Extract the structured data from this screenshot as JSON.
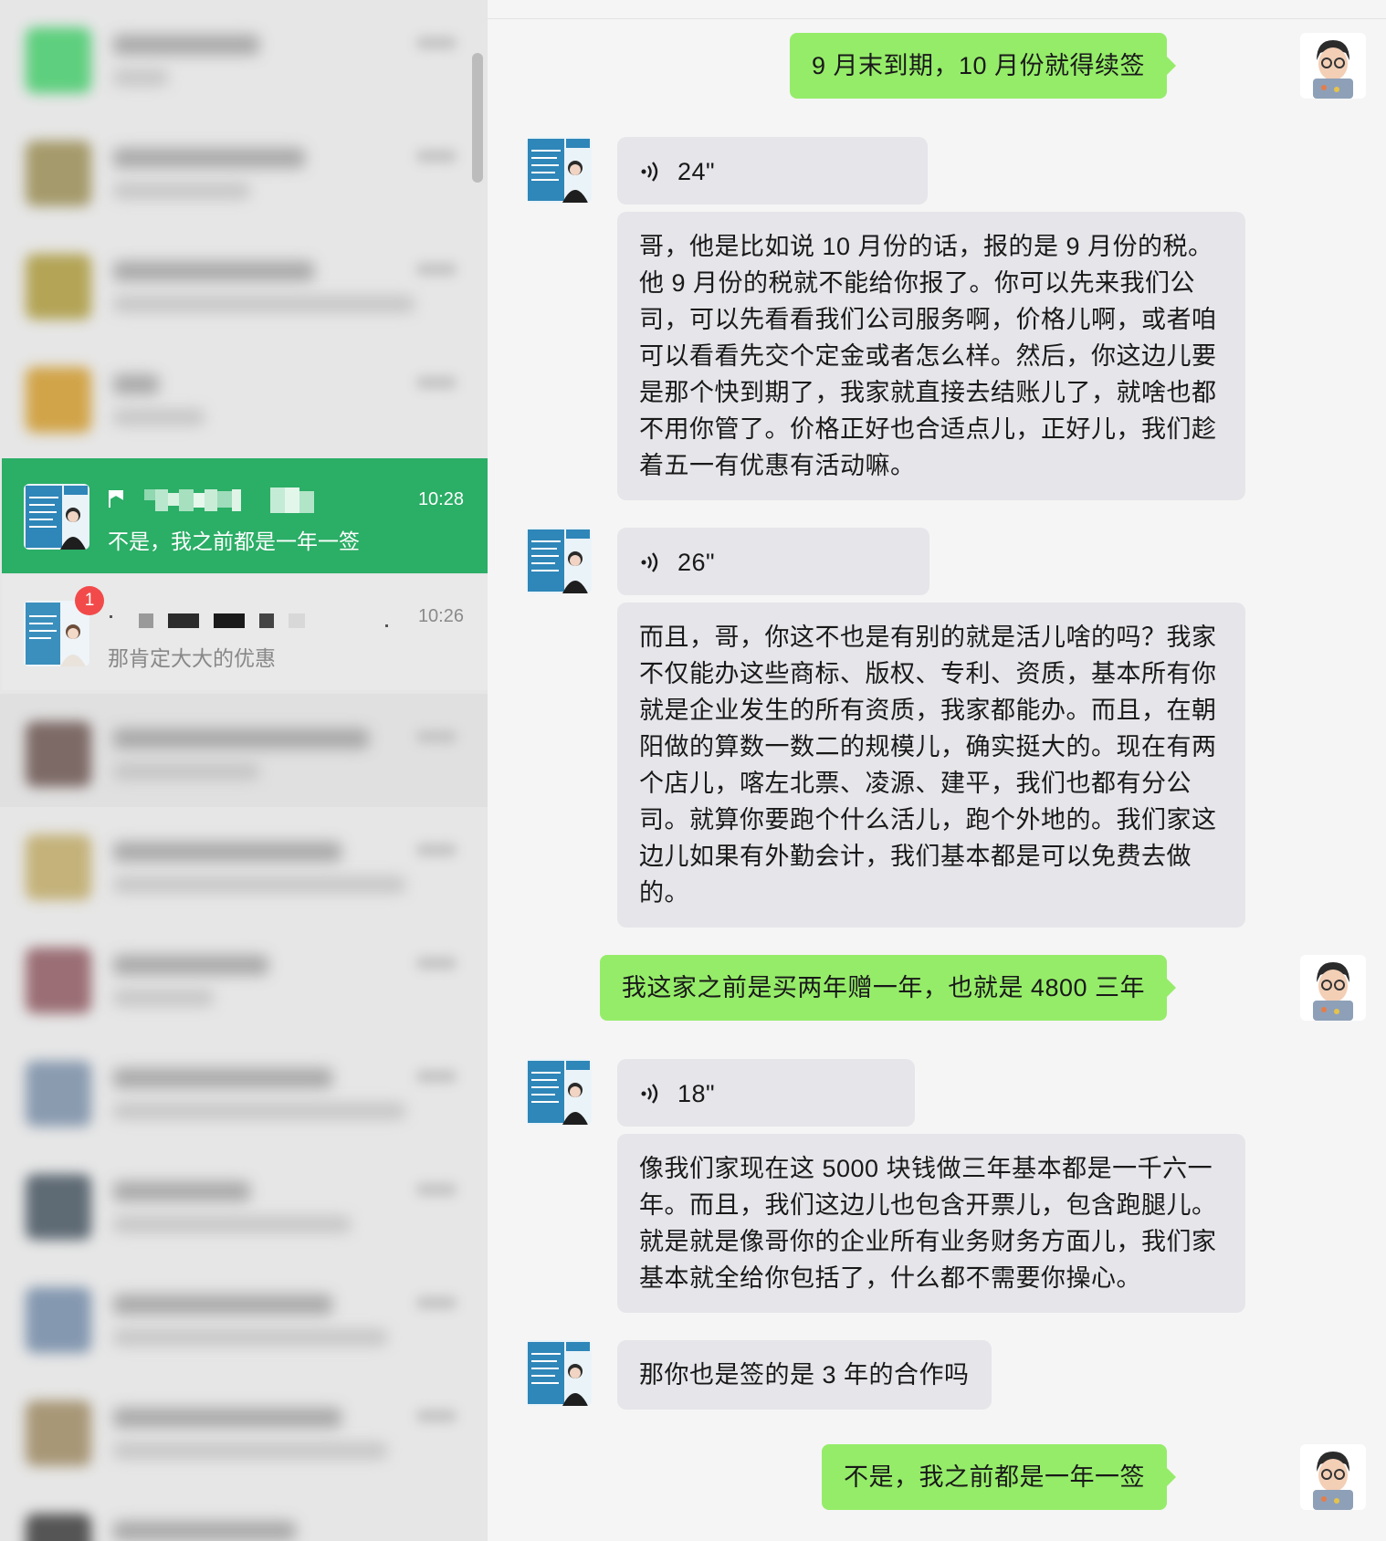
{
  "sidebar": {
    "active_conversation": {
      "time": "10:28",
      "preview": "不是，我之前都是一年一签"
    },
    "second_conversation": {
      "time": "10:26",
      "preview": "那肯定大大的优惠",
      "unread_count": "1"
    }
  },
  "messages": [
    {
      "from": "me",
      "type": "text",
      "text": "9 月末到期，10 月份就得续签"
    },
    {
      "from": "other",
      "type": "voice",
      "duration": "24\""
    },
    {
      "from": "other",
      "type": "transcript",
      "lines": [
        "哥，他是比如说 10 月份的话，报的是 9 月份的税。",
        "他 9 月份的税就不能给你报了。你可以先来我们公",
        "司，可以先看看我们公司服务啊，价格儿啊，或者咱",
        "可以看看先交个定金或者怎么样。然后，你这边儿要",
        "是那个快到期了，我家就直接去结账儿了，就啥也都",
        "不用你管了。价格正好也合适点儿，正好儿，我们趁",
        "着五一有优惠有活动嘛。"
      ]
    },
    {
      "from": "other",
      "type": "voice",
      "duration": "26\""
    },
    {
      "from": "other",
      "type": "transcript",
      "lines": [
        "而且，哥，你这不也是有别的就是活儿啥的吗？我家",
        "不仅能办这些商标、版权、专利、资质，基本所有你",
        "就是企业发生的所有资质，我家都能办。而且，在朝",
        "阳做的算数一数二的规模儿，确实挺大的。现在有两",
        "个店儿，喀左北票、凌源、建平，我们也都有分公",
        "司。就算你要跑个什么活儿，跑个外地的。我们家这",
        "边儿如果有外勤会计，我们基本都是可以免费去做",
        "的。"
      ]
    },
    {
      "from": "me",
      "type": "text",
      "text": "我这家之前是买两年赠一年，也就是 4800 三年"
    },
    {
      "from": "other",
      "type": "voice",
      "duration": "18\""
    },
    {
      "from": "other",
      "type": "transcript",
      "lines": [
        "像我们家现在这 5000 块钱做三年基本都是一千六一",
        "年。而且，我们这边儿也包含开票儿，包含跑腿儿。",
        "就是就是像哥你的企业所有业务财务方面儿，我们家",
        "基本就全给你包括了，什么都不需要你操心。"
      ]
    },
    {
      "from": "other",
      "type": "text",
      "text": "那你也是签的是 3 年的合作吗"
    },
    {
      "from": "me",
      "type": "text",
      "text": "不是，我之前都是一年一签"
    }
  ],
  "colors": {
    "accent_green": "#2bae66",
    "my_bubble": "#95ec69",
    "other_bubble": "#e5e5ea",
    "unread_badge": "#f24a4a"
  }
}
